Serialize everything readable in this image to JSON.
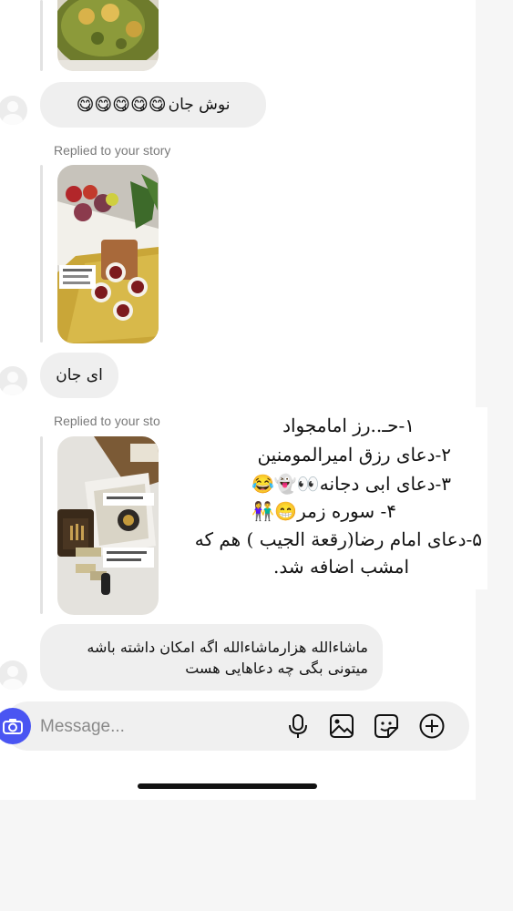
{
  "messages": {
    "reply1_text": "نوش جان",
    "reply1_emoji": "😋😋😋😋😋",
    "replied_label_1": "Replied to your story",
    "reply2_text": "ای جان",
    "replied_label_2": "Replied to your sto",
    "reply3_lines": [
      "ماشاءالله هزارماشاءالله اگه امکان داشته باشه",
      "میتونی بگی چه دعاهایی هست"
    ]
  },
  "overlay": {
    "lines": [
      "۱-حـ..رز امامجواد",
      "۲-دعای رزق امیرالمومنین",
      "۳-دعای ابی دجانه👀👻😂",
      "۴- سوره زمر😁👫",
      "۵-دعای امام رضا(رقعة الجيب ) هم که",
      "امشب اضافه شد."
    ]
  },
  "composer": {
    "placeholder": "Message...",
    "icons": [
      "camera-icon",
      "microphone-icon",
      "gallery-icon",
      "sticker-icon",
      "add-icon"
    ]
  }
}
